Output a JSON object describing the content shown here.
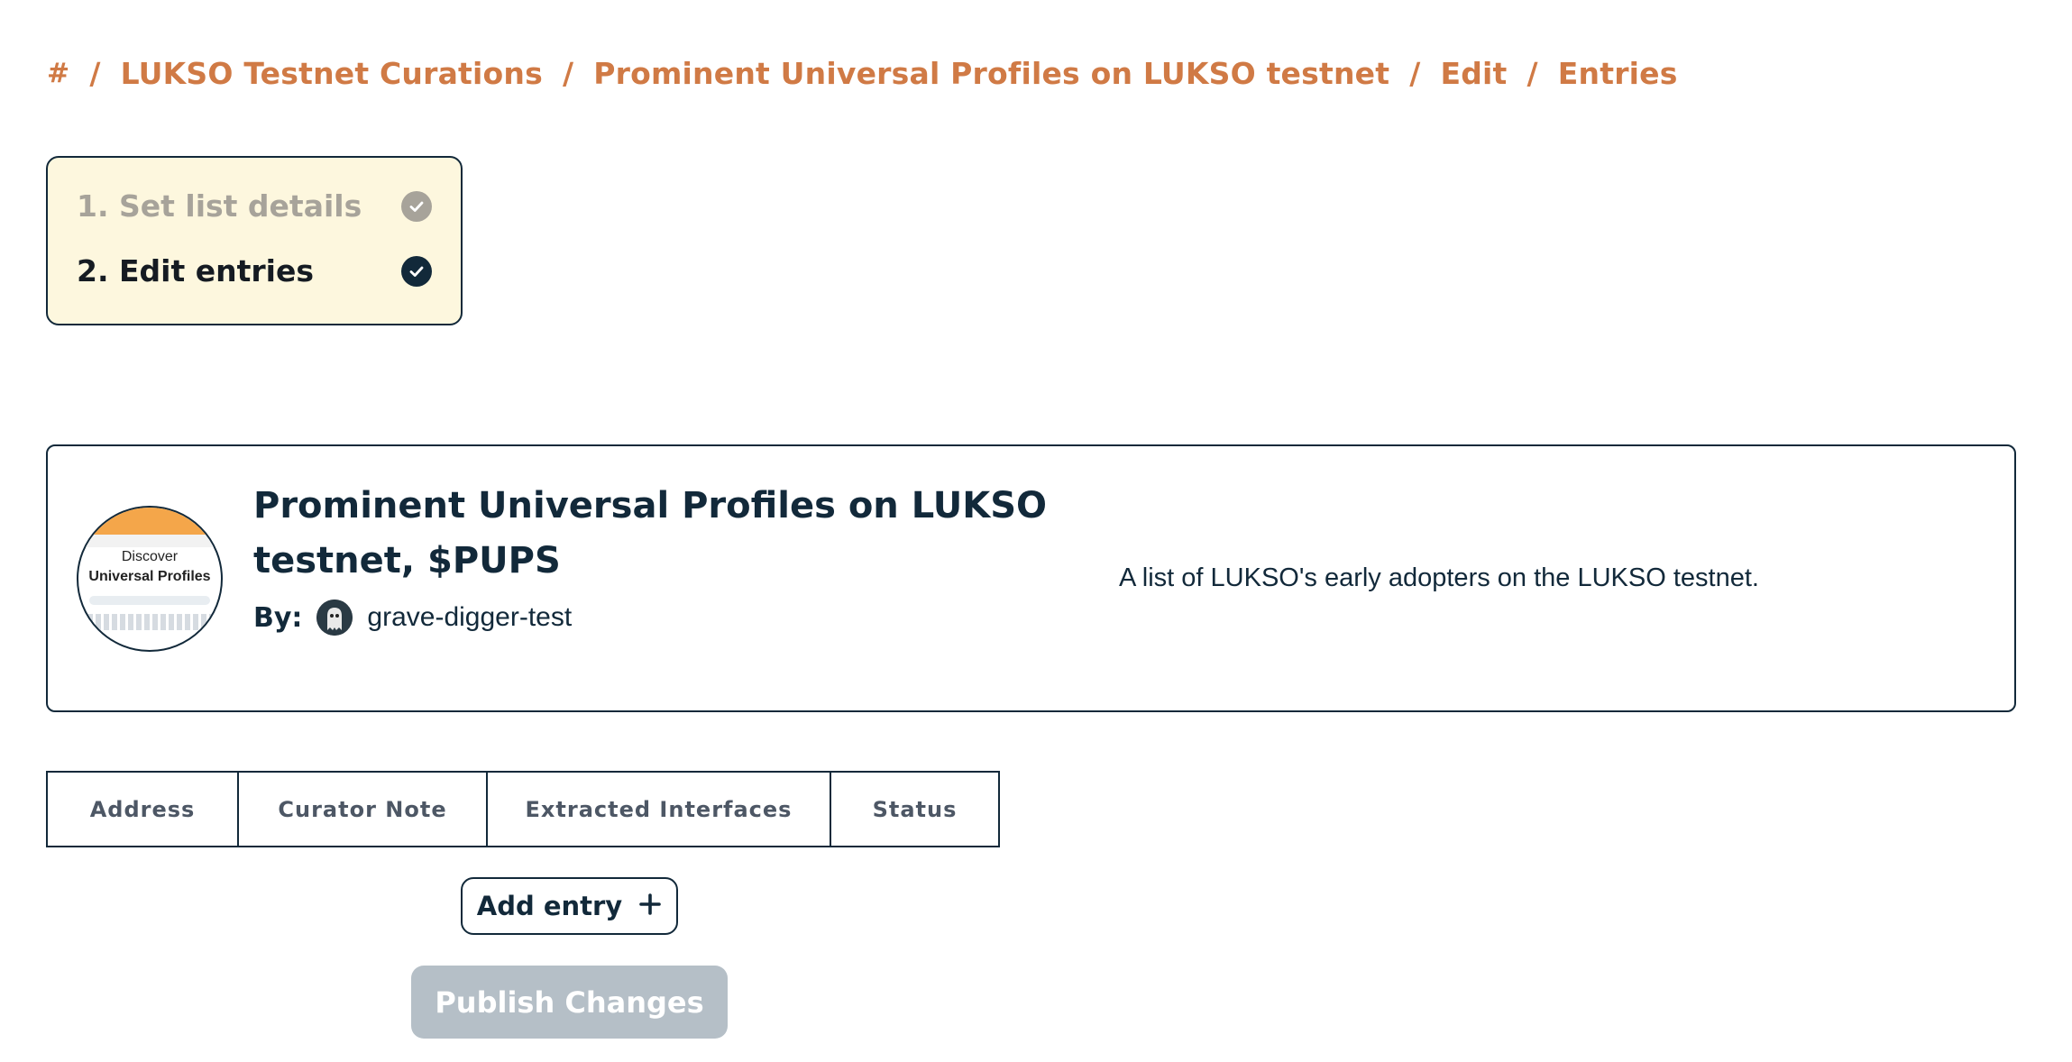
{
  "breadcrumb": {
    "home_glyph": "#",
    "items": [
      "LUKSO Testnet Curations",
      "Prominent Universal Profiles on LUKSO testnet",
      "Edit",
      "Entries"
    ],
    "separator": "/",
    "color": "#d07a45"
  },
  "steps": [
    {
      "label": "1. Set list details",
      "state": "completed"
    },
    {
      "label": "2. Edit entries",
      "state": "current"
    }
  ],
  "list": {
    "title": "Prominent Universal Profiles on LUKSO testnet, $PUPS",
    "by_label": "By:",
    "author": "grave-digger-test",
    "description": "A list of LUKSO's early adopters on the LUKSO testnet.",
    "image_text_line1": "Discover",
    "image_text_line2": "Universal Profiles"
  },
  "table": {
    "headers": [
      "Address",
      "Curator Note",
      "Extracted Interfaces",
      "Status"
    ]
  },
  "actions": {
    "add_entry": "Add entry",
    "add_icon": "plus-icon",
    "publish": "Publish Changes",
    "publish_enabled": false
  },
  "colors": {
    "text": "#12293a",
    "accent": "#d07a45",
    "steps_bg": "#fdf7de",
    "disabled_button": "#b5bfc7"
  }
}
